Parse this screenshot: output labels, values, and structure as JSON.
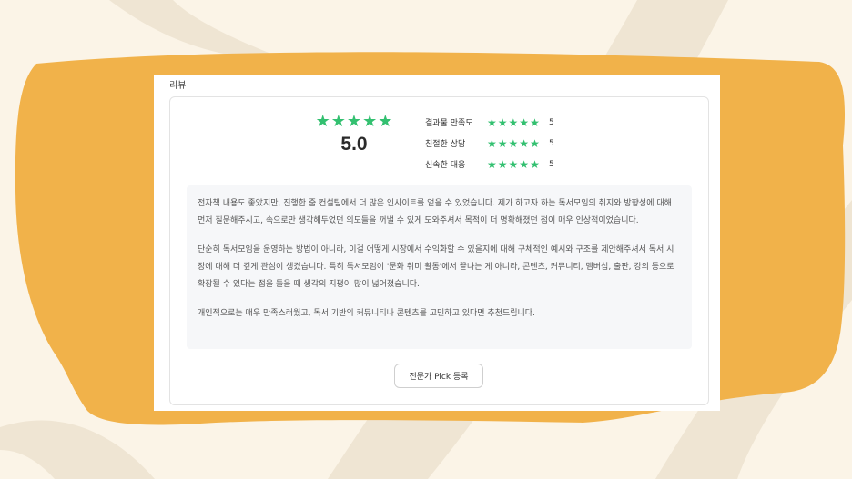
{
  "section_title": "리뷰",
  "overall": {
    "score": "5.0",
    "rating": 5,
    "star_color": "#33c070"
  },
  "criteria": [
    {
      "label": "결과물 만족도",
      "value": "5"
    },
    {
      "label": "친절한 상담",
      "value": "5"
    },
    {
      "label": "신속한 대응",
      "value": "5"
    }
  ],
  "review_paragraphs": [
    "전자책 내용도 좋았지만, 진행한 줌 컨설팅에서 더 많은 인사이트를 얻을 수 있었습니다. 제가 하고자 하는 독서모임의 취지와 방향성에 대해 먼저 질문해주시고, 속으로만 생각해두었던 의도들을 꺼낼 수 있게 도와주셔서 목적이 더 명확해졌던 점이 매우 인상적이었습니다.",
    "단순히 독서모임을 운영하는 방법이 아니라, 이걸 어떻게 시장에서 수익화할 수 있을지에 대해 구체적인 예시와 구조를 제안해주셔서 독서 시장에 대해 더 깊게 관심이 생겼습니다. 특히 독서모임이 '문화 취미 활동'에서 끝나는 게 아니라, 콘텐츠, 커뮤니티, 멤버십, 출판, 강의 등으로 확장될 수 있다는 점을 들을 때 생각의 지평이 많이 넓어졌습니다.",
    "개인적으로는 매우 만족스러웠고, 독서 기반의 커뮤니티나 콘텐츠를 고민하고 있다면 추천드립니다."
  ],
  "pick_button_label": "전문가 Pick 등록",
  "colors": {
    "background": "#fbf4e7",
    "blob": "#f1b24a",
    "stroke": "#efe5d3"
  }
}
